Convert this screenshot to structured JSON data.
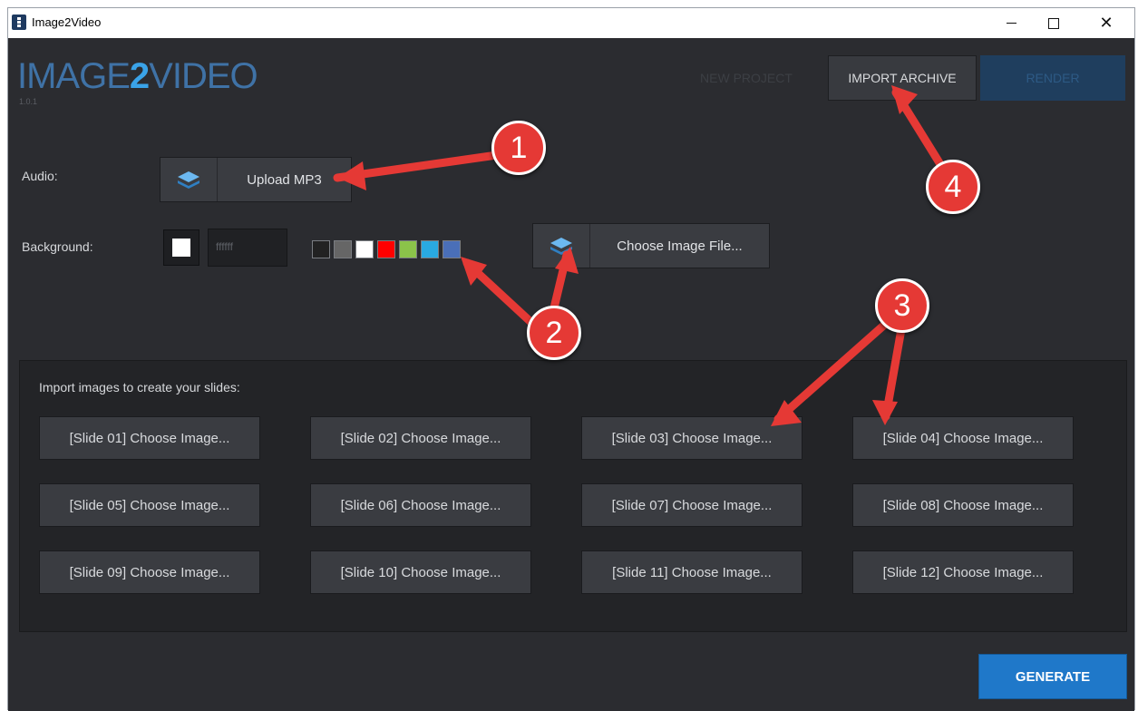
{
  "window": {
    "title": "Image2Video",
    "controls": {
      "minimize": "–",
      "maximize": "□",
      "close": "✕"
    }
  },
  "logo": {
    "prefix": "IMAGE",
    "number": "2",
    "suffix": "VIDEO",
    "version": "1.0.1"
  },
  "toolbar": {
    "new_project": "NEW PROJECT",
    "import_archive": "IMPORT ARCHIVE",
    "render": "RENDER"
  },
  "audio": {
    "label": "Audio:",
    "upload_label": "Upload MP3",
    "icon": "layers-icon"
  },
  "background": {
    "label": "Background:",
    "selected_color": "#ffffff",
    "hex_value": "ffffff",
    "swatches": [
      "#222222",
      "#666666",
      "#ffffff",
      "#ff0000",
      "#8bc34a",
      "#29a9e1",
      "#4a6fb8"
    ],
    "choose_image_label": "Choose Image File...",
    "icon": "layers-icon"
  },
  "slides": {
    "title": "Import images to create your slides:",
    "buttons": [
      "[Slide 01] Choose Image...",
      "[Slide 02] Choose Image...",
      "[Slide 03] Choose Image...",
      "[Slide 04] Choose Image...",
      "[Slide 05] Choose Image...",
      "[Slide 06] Choose Image...",
      "[Slide 07] Choose Image...",
      "[Slide 08] Choose Image...",
      "[Slide 09] Choose Image...",
      "[Slide 10] Choose Image...",
      "[Slide 11] Choose Image...",
      "[Slide 12] Choose Image..."
    ]
  },
  "generate_label": "GENERATE",
  "annotations": {
    "markers": [
      "1",
      "2",
      "3",
      "4"
    ],
    "color": "#e53935"
  }
}
